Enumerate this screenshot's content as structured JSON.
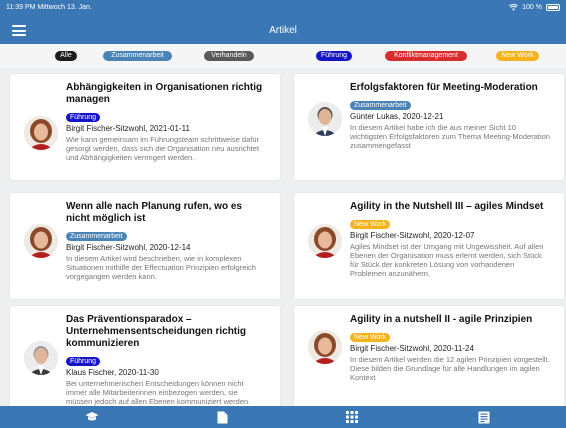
{
  "status": {
    "time": "11:39 PM",
    "date": "Mittwoch 13. Jan.",
    "battery": "100 %"
  },
  "nav": {
    "title": "Artikel"
  },
  "filters": [
    {
      "label": "Alle",
      "color": "#1c1c1c"
    },
    {
      "label": "Zusammenarbeit",
      "color": "#4a84b7"
    },
    {
      "label": "Verhandeln",
      "color": "#5a5a5a"
    },
    {
      "label": "Führung",
      "color": "#1515c8"
    },
    {
      "label": "Konfliktmanagement",
      "color": "#d92c2c"
    },
    {
      "label": "New Work",
      "color": "#f4b21e"
    }
  ],
  "articles": [
    {
      "title": "Abhängigkeiten in Organisationen richtig managen",
      "tag": "Führung",
      "tag_color": "#1515c8",
      "author": "Birgit Fischer-Sitzwohl, 2021-01-11",
      "excerpt": "Wie kann gemeinsam im Führungsteam schrittweise dafür gesorgt werden, dass sich die Organisation neu ausrichtet und Abhängigkeiten verringert werden."
    },
    {
      "title": "Erfolgsfaktoren für Meeting-Moderation",
      "tag": "Zusammenarbeit",
      "tag_color": "#4a84b7",
      "author": "Günter Lukas, 2020-12-21",
      "excerpt": "In diesem Artikel habe ich die aus meiner Sicht 10 wichtigsten Erfolgsfaktoren zum Thema Meeting-Moderation zusammengefasst"
    },
    {
      "title": "Wenn alle nach Planung rufen, wo es nicht möglich ist",
      "tag": "Zusammenarbeit",
      "tag_color": "#4a84b7",
      "author": "Birgit Fischer-Sitzwohl, 2020-12-14",
      "excerpt": "In diesem Artikel wird beschrieben, wie in komplexen Situationen mithilfe der Effectuation Prinzipien erfolgreich vorgegangen werden kann."
    },
    {
      "title": "Agility in the Nutshell III – agiles Mindset",
      "tag": "New Work",
      "tag_color": "#f4b21e",
      "author": "Birgit Fischer-Sitzwohl, 2020-12-07",
      "excerpt": "Agiles Mindset ist der Umgang mit Ungewissheit. Auf allen Ebenen der Organisation muss erlernt werden, sich Stück für Stück der konkreten Lösung von vorhandenen Problemen anzunähern."
    },
    {
      "title": "Das Präventionsparadox – Unternehmensentscheidungen richtig kommunizieren",
      "tag": "Führung",
      "tag_color": "#1515c8",
      "author": "Klaus Fischer, 2020-11-30",
      "excerpt": "Bei unternehmerischen Entscheidungen können nicht immer alle Mitarbeiterinnen einbezogen werden, sie müssen jedoch auf allen Ebenen kommuniziert werden."
    },
    {
      "title": "Agility in a nutshell II - agile Prinzipien",
      "tag": "New Work",
      "tag_color": "#f4b21e",
      "author": "Birgit Fischer-Sitzwohl, 2020-11-24",
      "excerpt": "In diesem Artikel werden die 12 agilen Prinzipien vorgestellt. Diese bilden die Grundlage für alle Handlungen im agilen Kontext"
    }
  ],
  "tabs": [
    {
      "icon": "graduation-cap-icon"
    },
    {
      "icon": "document-icon"
    },
    {
      "icon": "apps-grid-icon"
    },
    {
      "icon": "news-icon"
    }
  ]
}
